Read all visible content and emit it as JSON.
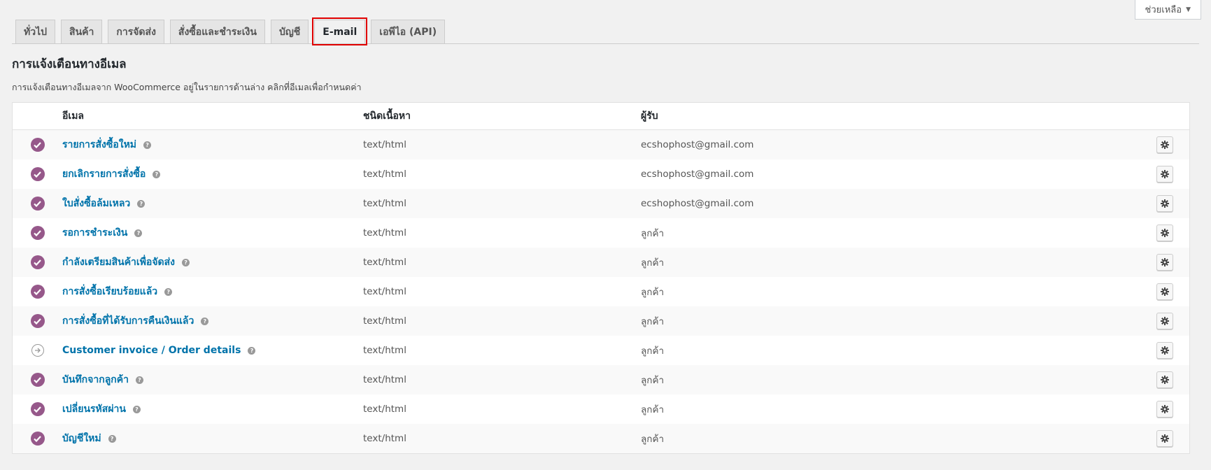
{
  "help": {
    "label": "ช่วยเหลือ",
    "caret": "▼"
  },
  "tabs": [
    {
      "label": "ทั่วไป",
      "active": false
    },
    {
      "label": "สินค้า",
      "active": false
    },
    {
      "label": "การจัดส่ง",
      "active": false
    },
    {
      "label": "สั่งซื้อและชำระเงิน",
      "active": false
    },
    {
      "label": "บัญชี",
      "active": false
    },
    {
      "label": "E-mail",
      "active": true
    },
    {
      "label": "เอพีไอ (API)",
      "active": false
    }
  ],
  "section": {
    "title": "การแจ้งเตือนทางอีเมล",
    "description": "การแจ้งเตือนทางอีเมลจาก WooCommerce อยู่ในรายการด้านล่าง คลิกที่อีเมลเพื่อกำหนดค่า"
  },
  "table": {
    "headers": {
      "email": "อีเมล",
      "content_type": "ชนิดเนื้อหา",
      "recipient": "ผู้รับ"
    },
    "rows": [
      {
        "name": "รายการสั่งซื้อใหม่",
        "type": "text/html",
        "recipient": "ecshophost@gmail.com",
        "status": "enabled"
      },
      {
        "name": "ยกเลิกรายการสั่งซื้อ",
        "type": "text/html",
        "recipient": "ecshophost@gmail.com",
        "status": "enabled"
      },
      {
        "name": "ใบสั่งซื้อล้มเหลว",
        "type": "text/html",
        "recipient": "ecshophost@gmail.com",
        "status": "enabled"
      },
      {
        "name": "รอการชำระเงิน",
        "type": "text/html",
        "recipient": "ลูกค้า",
        "status": "enabled"
      },
      {
        "name": "กำลังเตรียมสินค้าเพื่อจัดส่ง",
        "type": "text/html",
        "recipient": "ลูกค้า",
        "status": "enabled"
      },
      {
        "name": "การสั่งซื้อเรียบร้อยแล้ว",
        "type": "text/html",
        "recipient": "ลูกค้า",
        "status": "enabled"
      },
      {
        "name": "การสั่งซื้อที่ได้รับการคืนเงินแล้ว",
        "type": "text/html",
        "recipient": "ลูกค้า",
        "status": "enabled"
      },
      {
        "name": "Customer invoice / Order details",
        "type": "text/html",
        "recipient": "ลูกค้า",
        "status": "manual"
      },
      {
        "name": "บันทึกจากลูกค้า",
        "type": "text/html",
        "recipient": "ลูกค้า",
        "status": "enabled"
      },
      {
        "name": "เปลี่ยนรหัสผ่าน",
        "type": "text/html",
        "recipient": "ลูกค้า",
        "status": "enabled"
      },
      {
        "name": "บัญชีใหม่",
        "type": "text/html",
        "recipient": "ลูกค้า",
        "status": "enabled"
      }
    ]
  },
  "colors": {
    "accent": "#96588a",
    "link": "#0073aa",
    "highlight": "#e00000"
  }
}
